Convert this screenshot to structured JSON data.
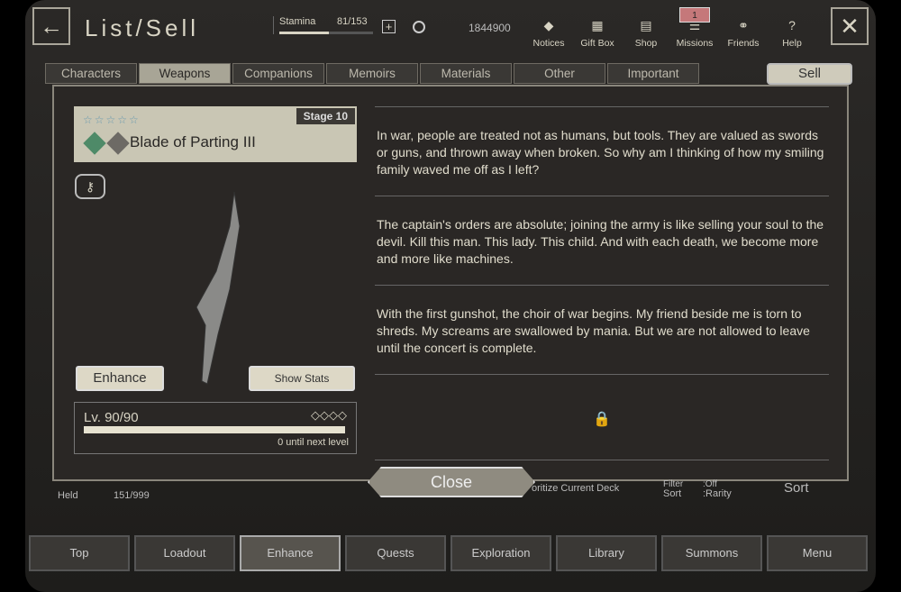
{
  "header": {
    "title": "List/Sell",
    "stamina_label": "Stamina",
    "stamina_value": "81/153",
    "stamina_fraction": 0.53,
    "currency": "1844900",
    "icons": [
      {
        "label": "Notices",
        "icon": "notice-icon"
      },
      {
        "label": "Gift Box",
        "icon": "gift-icon"
      },
      {
        "label": "Shop",
        "icon": "shop-icon"
      },
      {
        "label": "Missions",
        "icon": "missions-icon"
      },
      {
        "label": "Friends",
        "icon": "friends-icon"
      },
      {
        "label": "Help",
        "icon": "help-icon"
      }
    ],
    "missions_badge": "1"
  },
  "tabs": [
    "Characters",
    "Weapons",
    "Companions",
    "Memoirs",
    "Materials",
    "Other",
    "Important"
  ],
  "active_tab": "Weapons",
  "sell_label": "Sell",
  "weapon": {
    "name": "Blade of Parting III",
    "stage": "Stage 10",
    "rarity_stars": 5,
    "level": "Lv. 90/90",
    "next_level": "0 until next level",
    "level_fraction": 1.0,
    "enhance_label": "Enhance",
    "show_stats_label": "Show Stats"
  },
  "story": [
    "In war, people are treated not as humans, but tools. They are valued as swords or guns, and thrown away when broken. So why am I thinking of how my smiling family waved me off as I left?",
    "The captain's orders are absolute; joining the army is like selling your soul to the devil. Kill this man. This lady. This child. And with each death, we become more and more like machines.",
    "With the first gunshot, the choir of war begins. My friend beside me is torn to shreds. My screams are swallowed by mania. But we are not allowed to leave until the concert is complete."
  ],
  "close_label": "Close",
  "background": {
    "held_label": "Held",
    "held_value": "151/999",
    "deck_label": "oritize Current Deck",
    "filter_label": "Filter",
    "filter_value": ":Off",
    "sort_label": "Sort",
    "sort_value": ":Rarity",
    "sort_button": "Sort"
  },
  "nav": [
    "Top",
    "Loadout",
    "Enhance",
    "Quests",
    "Exploration",
    "Library",
    "Summons",
    "Menu"
  ],
  "active_nav": "Enhance"
}
